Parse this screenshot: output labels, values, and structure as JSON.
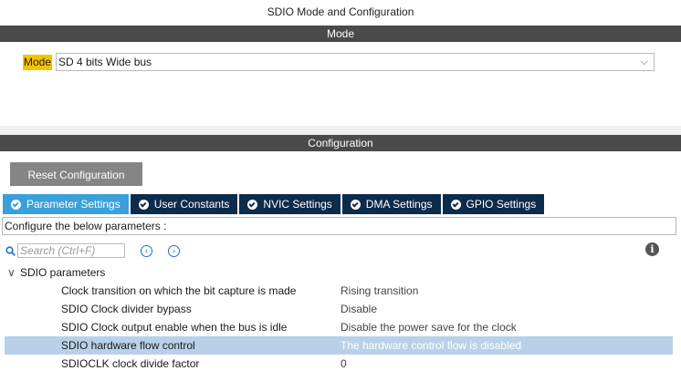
{
  "window_title": "SDIO Mode and Configuration",
  "mode_section": {
    "header": "Mode",
    "label": "Mode",
    "selected_value": "SD 4 bits Wide bus"
  },
  "config_section": {
    "header": "Configuration",
    "reset_button": "Reset Configuration",
    "tabs": [
      {
        "label": "Parameter Settings",
        "active": true
      },
      {
        "label": "User Constants",
        "active": false
      },
      {
        "label": "NVIC Settings",
        "active": false
      },
      {
        "label": "DMA Settings",
        "active": false
      },
      {
        "label": "GPIO Settings",
        "active": false
      }
    ],
    "description": "Configure the below parameters :",
    "search_placeholder": "Search (Ctrl+F)",
    "group": "SDIO parameters",
    "parameters": [
      {
        "name": "Clock transition on which the bit capture is made",
        "value": "Rising transition"
      },
      {
        "name": "SDIO Clock divider bypass",
        "value": "Disable"
      },
      {
        "name": "SDIO Clock output enable when the bus is idle",
        "value": "Disable the power save for the clock"
      },
      {
        "name": "SDIO hardware flow control",
        "value": "The hardware control flow is disabled",
        "selected": true
      },
      {
        "name": "SDIOCLK clock divide factor",
        "value": "0"
      }
    ]
  },
  "colors": {
    "header_bar": "#4a4a4a",
    "mode_highlight": "#f4c400",
    "tab_active": "#3aa0dc",
    "tab_inactive": "#0d2b4a",
    "row_selected": "#b8d1e8"
  }
}
